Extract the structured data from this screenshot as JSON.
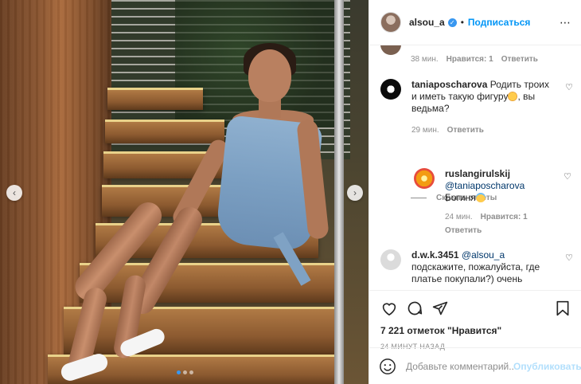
{
  "header": {
    "username": "alsou_a",
    "separator": "•",
    "follow_label": "Подписаться",
    "more_label": "⋯"
  },
  "photo": {
    "prev_label": "‹",
    "next_label": "›",
    "slide_count": 3,
    "active_slide": 1
  },
  "comments": {
    "top_meta": {
      "time": "38 мин.",
      "likes": "Нравится: 1",
      "reply": "Ответить"
    },
    "items": [
      {
        "username": "taniaposcharova",
        "text_before": "Родить троих и иметь такую фигуру",
        "text_after": ", вы ведьма?",
        "emoji": "heart-eyes-emoji",
        "time": "29 мин.",
        "reply": "Ответить"
      },
      {
        "username": "ruslangirulskij",
        "mention": "@taniaposcharova",
        "text": "Богиня",
        "emoji": "halo-smile-emoji",
        "time": "24 мин.",
        "likes": "Нравится: 1",
        "reply": "Ответить"
      },
      {
        "username": "d.w.k.3451",
        "mention": "@alsou_a",
        "text": "подскажите, пожалуйста, где платье покупали?) очень"
      }
    ],
    "hide_replies": "Скрыть ответы"
  },
  "likes_text": "7 221 отметок \"Нравится\"",
  "posted_time": "24 МИНУТ НАЗАД",
  "add_comment": {
    "placeholder": "Добавьте комментарий...",
    "publish_label": "Опубликовать"
  },
  "colors": {
    "accent": "#0095f6",
    "verified": "#3897f0",
    "muted": "#8e8e8e",
    "publish_disabled": "#b2dffc"
  }
}
